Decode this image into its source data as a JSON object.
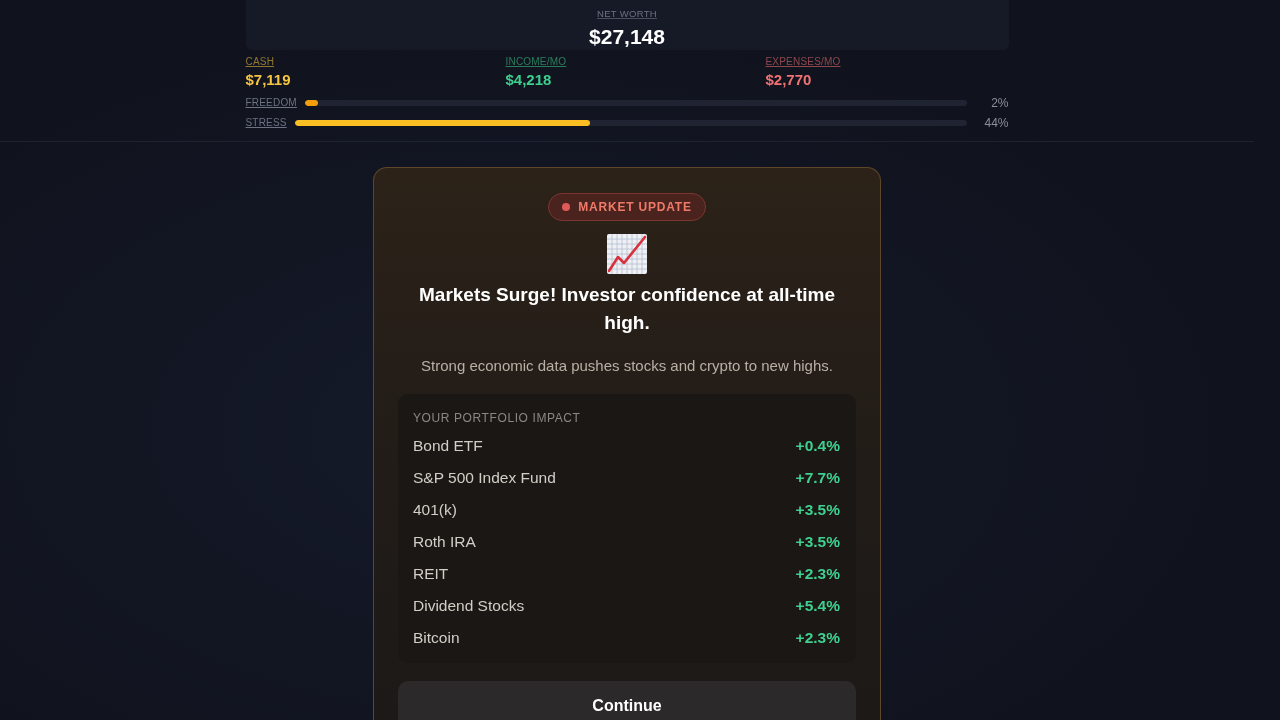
{
  "net_worth": {
    "label": "NET WORTH",
    "value": "$27,148"
  },
  "stats": [
    {
      "label": "CASH",
      "value": "$7,119",
      "color": "#f5c542"
    },
    {
      "label": "INCOME/MO",
      "value": "$4,218",
      "color": "#3ecf8e"
    },
    {
      "label": "EXPENSES/MO",
      "value": "$2,770",
      "color": "#f07272"
    }
  ],
  "meters": [
    {
      "label": "FREEDOM",
      "level": 0.02,
      "reading": "2%",
      "color": "#f59e0b"
    },
    {
      "label": "STRESS",
      "level": 0.44,
      "reading": "44%",
      "color": "#fbbf24"
    }
  ],
  "event": {
    "badge": "MARKET UPDATE",
    "title": "Markets Surge! Investor confidence at all-time high.",
    "description": "Strong economic data pushes stocks and crypto to new highs."
  },
  "portfolio_impact": {
    "heading": "YOUR PORTFOLIO IMPACT",
    "rows": [
      {
        "name": "Bond ETF",
        "change": "+0.4%"
      },
      {
        "name": "S&P 500 Index Fund",
        "change": "+7.7%"
      },
      {
        "name": "401(k)",
        "change": "+3.5%"
      },
      {
        "name": "Roth IRA",
        "change": "+3.5%"
      },
      {
        "name": "REIT",
        "change": "+2.3%"
      },
      {
        "name": "Dividend Stocks",
        "change": "+5.4%"
      },
      {
        "name": "Bitcoin",
        "change": "+2.3%"
      }
    ]
  },
  "buttons": [
    "Continue"
  ]
}
